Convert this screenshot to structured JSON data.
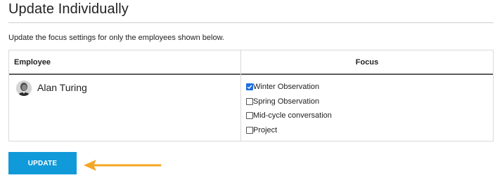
{
  "header": {
    "title": "Update Individually"
  },
  "description": "Update the focus settings for only the employees shown below.",
  "table": {
    "columns": {
      "employee": "Employee",
      "focus": "Focus"
    },
    "rows": [
      {
        "employee_name": "Alan Turing",
        "focus_options": [
          {
            "label": "Winter Observation",
            "checked": true
          },
          {
            "label": "Spring Observation",
            "checked": false
          },
          {
            "label": "Mid-cycle conversation",
            "checked": false
          },
          {
            "label": "Project",
            "checked": false
          }
        ]
      }
    ]
  },
  "actions": {
    "update_label": "UPDATE"
  },
  "colors": {
    "button": "#109ad9",
    "arrow": "#f5a623",
    "checkbox_checked": "#1d6fe0"
  },
  "icons": {
    "arrow": "left-arrow-icon",
    "avatar": "avatar-photo",
    "checked": "checkmark-icon"
  }
}
